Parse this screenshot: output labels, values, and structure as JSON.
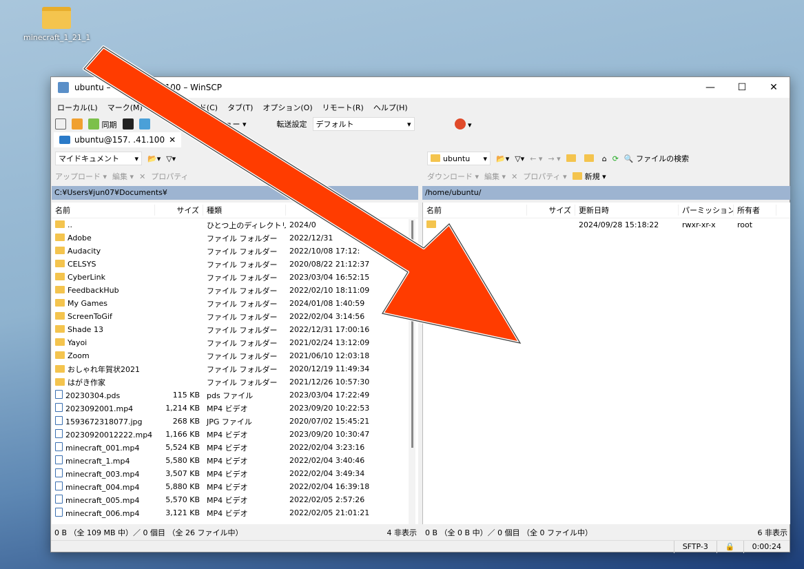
{
  "desktop": {
    "icon_label": "minecraft_1_21_1"
  },
  "window": {
    "title": "ubuntu – ",
    "title_tail": "41.100 – WinSCP",
    "menu": [
      "ローカル(L)",
      "マーク(M)",
      "",
      "ド(C)",
      "タブ(T)",
      "オプション(O)",
      "リモート(R)",
      "ヘルプ(H)"
    ],
    "toolbar": {
      "sync": "同期",
      "queue": "キュー",
      "transfer_label": "転送設定",
      "transfer_value": "デフォルト"
    },
    "tab": "ubuntu@157.  .41.100"
  },
  "left": {
    "location": "マイドキュメント",
    "upload": "アップロード",
    "edit": "編集",
    "props": "プロパティ",
    "path": "C:¥Users¥jun07¥Documents¥",
    "headers": [
      "名前",
      "サイズ",
      "種類",
      ""
    ],
    "rows": [
      [
        "..",
        "",
        "ひとつ上のディレクトリ",
        "2024/0",
        "up"
      ],
      [
        "Adobe",
        "",
        "ファイル フォルダー",
        "2022/12/31",
        "dir"
      ],
      [
        "Audacity",
        "",
        "ファイル フォルダー",
        "2022/10/08 17:12:",
        "dir"
      ],
      [
        "CELSYS",
        "",
        "ファイル フォルダー",
        "2020/08/22 21:12:37",
        "dir"
      ],
      [
        "CyberLink",
        "",
        "ファイル フォルダー",
        "2023/03/04 16:52:15",
        "dir"
      ],
      [
        "FeedbackHub",
        "",
        "ファイル フォルダー",
        "2022/02/10 18:11:09",
        "dir"
      ],
      [
        "My Games",
        "",
        "ファイル フォルダー",
        "2024/01/08 1:40:59",
        "dir"
      ],
      [
        "ScreenToGif",
        "",
        "ファイル フォルダー",
        "2022/02/04 3:14:56",
        "dir"
      ],
      [
        "Shade 13",
        "",
        "ファイル フォルダー",
        "2022/12/31 17:00:16",
        "dir"
      ],
      [
        "Yayoi",
        "",
        "ファイル フォルダー",
        "2021/02/24 13:12:09",
        "dir"
      ],
      [
        "Zoom",
        "",
        "ファイル フォルダー",
        "2021/06/10 12:03:18",
        "dir"
      ],
      [
        "おしゃれ年賀状2021",
        "",
        "ファイル フォルダー",
        "2020/12/19 11:49:34",
        "dir"
      ],
      [
        "はがき作家",
        "",
        "ファイル フォルダー",
        "2021/12/26 10:57:30",
        "dir"
      ],
      [
        "20230304.pds",
        "115 KB",
        "pds ファイル",
        "2023/03/04 17:22:49",
        "file"
      ],
      [
        "2023092001.mp4",
        "1,214 KB",
        "MP4 ビデオ",
        "2023/09/20 10:22:53",
        "file"
      ],
      [
        "1593672318077.jpg",
        "268 KB",
        "JPG ファイル",
        "2020/07/02 15:45:21",
        "file"
      ],
      [
        "20230920012222.mp4",
        "1,166 KB",
        "MP4 ビデオ",
        "2023/09/20 10:30:47",
        "file"
      ],
      [
        "minecraft_001.mp4",
        "5,524 KB",
        "MP4 ビデオ",
        "2022/02/04 3:23:16",
        "file"
      ],
      [
        "minecraft_1.mp4",
        "5,580 KB",
        "MP4 ビデオ",
        "2022/02/04 3:40:46",
        "file"
      ],
      [
        "minecraft_003.mp4",
        "3,507 KB",
        "MP4 ビデオ",
        "2022/02/04 3:49:34",
        "file"
      ],
      [
        "minecraft_004.mp4",
        "5,880 KB",
        "MP4 ビデオ",
        "2022/02/04 16:39:18",
        "file"
      ],
      [
        "minecraft_005.mp4",
        "5,570 KB",
        "MP4 ビデオ",
        "2022/02/05 2:57:26",
        "file"
      ],
      [
        "minecraft_006.mp4",
        "3,121 KB",
        "MP4 ビデオ",
        "2022/02/05 21:01:21",
        "file"
      ]
    ],
    "status": "0 B （全 109 MB 中）／ 0 個目 （全 26 ファイル中）",
    "hidden": "4 非表示"
  },
  "right": {
    "location": "ubuntu",
    "search": "ファイルの検索",
    "download": "ダウンロード",
    "edit": "編集",
    "props": "プロパティ",
    "new": "新規",
    "path": "/home/ubuntu/",
    "headers": [
      "名前",
      "サイズ",
      "更新日時",
      "パーミッション",
      "所有者"
    ],
    "rows": [
      [
        "",
        "",
        "2024/09/28 15:18:22",
        "rwxr-xr-x",
        "root"
      ]
    ],
    "status": "0 B （全 0 B 中）／ 0 個目 （全 0 ファイル中）",
    "hidden": "6 非表示"
  },
  "bottom": {
    "protocol": "SFTP-3",
    "time": "0:00:24"
  },
  "colors": {
    "arrow": "#ff3c00",
    "pathbar": "#9db4d1",
    "folder": "#f4c44e"
  }
}
